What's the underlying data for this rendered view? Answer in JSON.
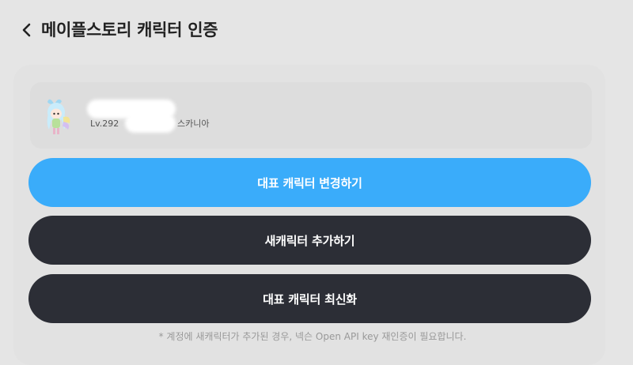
{
  "header": {
    "title": "메이플스토리 캐릭터 인증",
    "back_icon": "chevron-left-icon"
  },
  "character": {
    "avatar_icon": "maplestory-character-avatar",
    "level": "Lv.292",
    "world": "스카니아"
  },
  "buttons": {
    "change_rep": "대표 캐릭터 변경하기",
    "add_char": "새캐릭터 추가하기",
    "refresh_rep": "대표 캐릭터 최신화"
  },
  "notice": "* 계정에 새캐릭터가 추가된 경우, 넥슨 Open API key 재인증이 필요합니다.",
  "colors": {
    "primary": "#3aacfa",
    "dark_button": "#2c2e36",
    "background": "#e5e5e5"
  }
}
